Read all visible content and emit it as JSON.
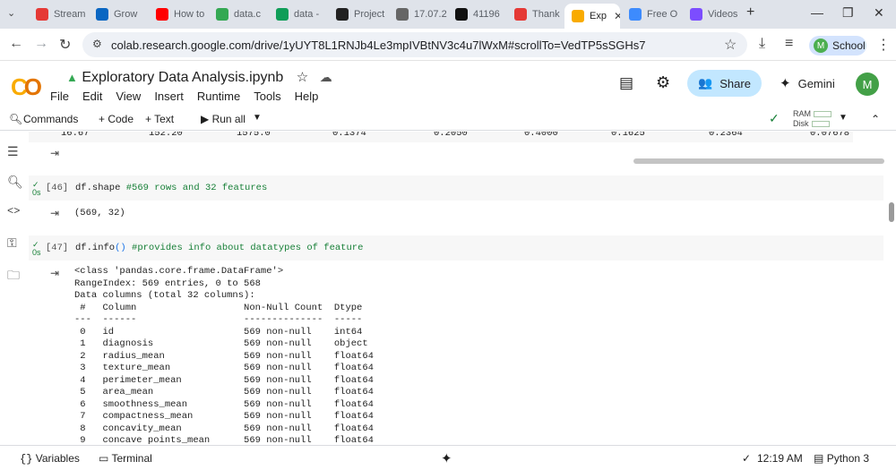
{
  "browser": {
    "tabs": [
      {
        "label": "Stream",
        "color": "#e53935"
      },
      {
        "label": "Grow",
        "color": "#0a66c2"
      },
      {
        "label": "How to",
        "color": "#ff0000"
      },
      {
        "label": "data.c",
        "color": "#34a853"
      },
      {
        "label": "data -",
        "color": "#0f9d58"
      },
      {
        "label": "Project",
        "color": "#222222"
      },
      {
        "label": "17.07.2",
        "color": "#666666"
      },
      {
        "label": "41196",
        "color": "#111111"
      },
      {
        "label": "Thank",
        "color": "#e53935"
      },
      {
        "label": "Exp",
        "color": "#f9ab00"
      },
      {
        "label": "Free O",
        "color": "#3d8bfd"
      },
      {
        "label": "Videos",
        "color": "#7c4dff"
      }
    ],
    "url": "colab.research.google.com/drive/1yUYT8L1RNJb4Le3mpIVBtNV3c4u7lWxM#scrollTo=VedTP5sSGHs7",
    "profile_label": "School",
    "profile_initial": "M"
  },
  "colab": {
    "notebook_title": "Exploratory Data Analysis.ipynb",
    "menu": [
      "File",
      "Edit",
      "View",
      "Insert",
      "Runtime",
      "Tools",
      "Help"
    ],
    "share_label": "Share",
    "gemini_label": "Gemini",
    "user_initial": "M",
    "toolbar": {
      "commands": "Commands",
      "code": "+ Code",
      "text": "+ Text",
      "run_all": "Run all",
      "ram": "RAM",
      "disk": "Disk"
    }
  },
  "prev_row": [
    "16.67",
    "152.20",
    "1575.0",
    "0.1374",
    "0.2050",
    "0.4000",
    "0.1625",
    "0.2364",
    "0.07678"
  ],
  "cells": [
    {
      "number": "[46]",
      "code": "df.shape",
      "comment": "#569 rows and 32 features",
      "exec_time": "0s",
      "output": "(569, 32)"
    },
    {
      "number": "[47]",
      "code": "df.info",
      "code_parens": "()",
      "comment": "#provides info about datatypes of feature",
      "exec_time": "0s",
      "output": "<class 'pandas.core.frame.DataFrame'>\nRangeIndex: 569 entries, 0 to 568\nData columns (total 32 columns):\n #   Column                   Non-Null Count  Dtype  \n---  ------                   --------------  -----  \n 0   id                       569 non-null    int64  \n 1   diagnosis                569 non-null    object \n 2   radius_mean              569 non-null    float64\n 3   texture_mean             569 non-null    float64\n 4   perimeter_mean           569 non-null    float64\n 5   area_mean                569 non-null    float64\n 6   smoothness_mean          569 non-null    float64\n 7   compactness_mean         569 non-null    float64\n 8   concavity_mean           569 non-null    float64\n 9   concave points_mean      569 non-null    float64"
    }
  ],
  "status": {
    "variables": "Variables",
    "terminal": "Terminal",
    "time": "12:19 AM",
    "runtime": "Python 3"
  }
}
